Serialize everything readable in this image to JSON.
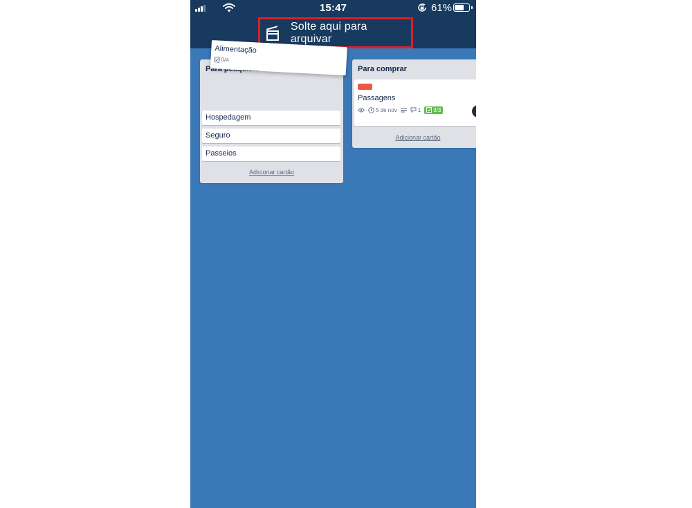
{
  "status_bar": {
    "time": "15:47",
    "battery_percent": "61%",
    "battery_level": 0.61,
    "signal_bars": 3,
    "icons": [
      "signal-icon",
      "wifi-icon",
      "rotation-lock-icon",
      "battery-icon"
    ]
  },
  "archive_zone": {
    "label": "Solte aqui para arquivar",
    "icon": "archive-icon",
    "highlight_color": "#e01e2a"
  },
  "colors": {
    "board_background": "#3a78b8",
    "header_background": "#173a5e",
    "list_background": "#dfe1e6",
    "label_red": "#eb5a46",
    "checklist_complete": "#61bd4f"
  },
  "dragging_card": {
    "title": "Alimentação",
    "checklist": "0/4"
  },
  "lists": [
    {
      "title": "Para pesquisar",
      "cards": [
        {
          "title": "Hospedagem"
        },
        {
          "title": "Seguro"
        },
        {
          "title": "Passeios"
        }
      ],
      "add_card_label": "Adicionar cartão"
    },
    {
      "title": "Para comprar",
      "cards": [
        {
          "title": "Passagens",
          "label_color": "#eb5a46",
          "due_date": "5 de nov",
          "comments": "1",
          "checklist": "3/3",
          "watching": true,
          "has_description": true
        }
      ],
      "add_card_label": "Adicionar cartão"
    }
  ]
}
